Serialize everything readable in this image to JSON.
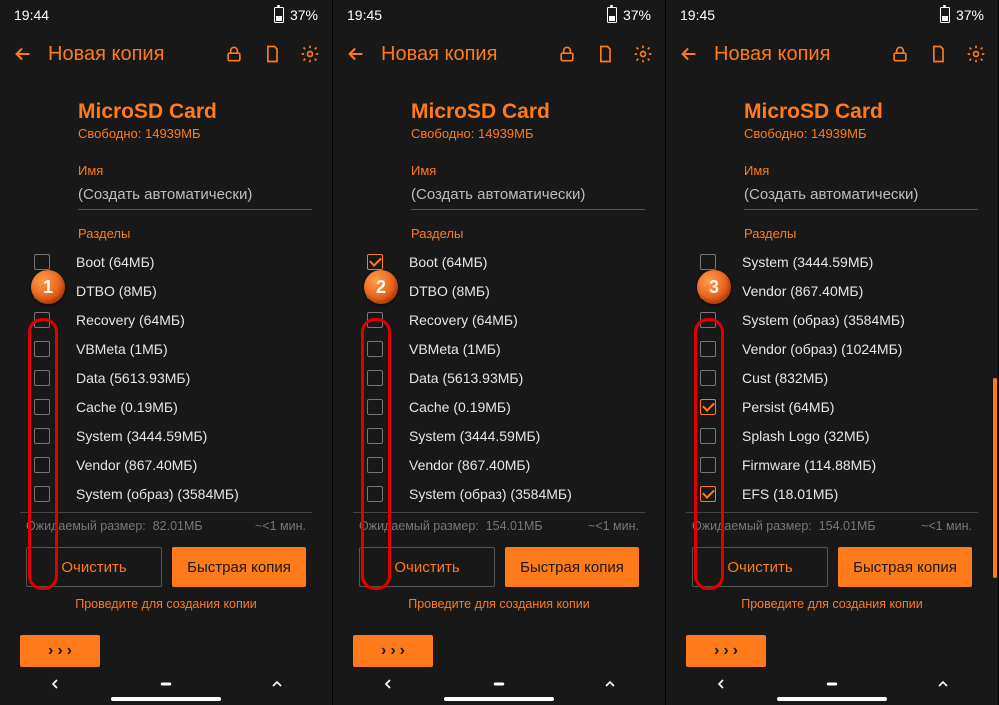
{
  "status": {
    "time": [
      "19:44",
      "19:45",
      "19:45"
    ],
    "battery": "37%"
  },
  "header": {
    "title": "Новая копия"
  },
  "card": {
    "title": "MicroSD Card",
    "subtitle": "Свободно: 14939МБ"
  },
  "name": {
    "label": "Имя",
    "placeholder": "(Создать автоматически)"
  },
  "partitions_label": "Разделы",
  "expected_label": "Ожидаемый размер:",
  "time_est": "~<1 мин.",
  "clear_label": "Очистить",
  "fast_label": "Быстрая копия",
  "swipe_hint": "Проведите для создания копии",
  "screens": [
    {
      "step": "1",
      "items": [
        {
          "label": "Boot (64МБ)",
          "checked": false
        },
        {
          "label": "DTBO (8МБ)",
          "checked": false
        },
        {
          "label": "Recovery (64МБ)",
          "checked": false
        },
        {
          "label": "VBMeta (1МБ)",
          "checked": false
        },
        {
          "label": "Data (5613.93МБ)",
          "checked": false
        },
        {
          "label": "Cache (0.19МБ)",
          "checked": false
        },
        {
          "label": "System (3444.59МБ)",
          "checked": false
        },
        {
          "label": "Vendor (867.40МБ)",
          "checked": false
        },
        {
          "label": "System (образ) (3584МБ)",
          "checked": false
        }
      ],
      "expected_size": "82.01МБ"
    },
    {
      "step": "2",
      "items": [
        {
          "label": "Boot (64МБ)",
          "checked": true
        },
        {
          "label": "DTBO (8МБ)",
          "checked": true
        },
        {
          "label": "Recovery (64МБ)",
          "checked": false
        },
        {
          "label": "VBMeta (1МБ)",
          "checked": false
        },
        {
          "label": "Data (5613.93МБ)",
          "checked": false
        },
        {
          "label": "Cache (0.19МБ)",
          "checked": false
        },
        {
          "label": "System (3444.59МБ)",
          "checked": false
        },
        {
          "label": "Vendor (867.40МБ)",
          "checked": false
        },
        {
          "label": "System (образ) (3584МБ)",
          "checked": false
        }
      ],
      "expected_size": "154.01МБ"
    },
    {
      "step": "3",
      "items": [
        {
          "label": "System (3444.59МБ)",
          "checked": false
        },
        {
          "label": "Vendor (867.40МБ)",
          "checked": false
        },
        {
          "label": "System (образ) (3584МБ)",
          "checked": false
        },
        {
          "label": "Vendor (образ) (1024МБ)",
          "checked": false
        },
        {
          "label": "Cust (832МБ)",
          "checked": false
        },
        {
          "label": "Persist (64МБ)",
          "checked": true
        },
        {
          "label": "Splash Logo (32МБ)",
          "checked": false
        },
        {
          "label": "Firmware (114.88МБ)",
          "checked": false
        },
        {
          "label": "EFS (18.01МБ)",
          "checked": true
        }
      ],
      "expected_size": "154.01МБ",
      "scrolled": true
    }
  ]
}
